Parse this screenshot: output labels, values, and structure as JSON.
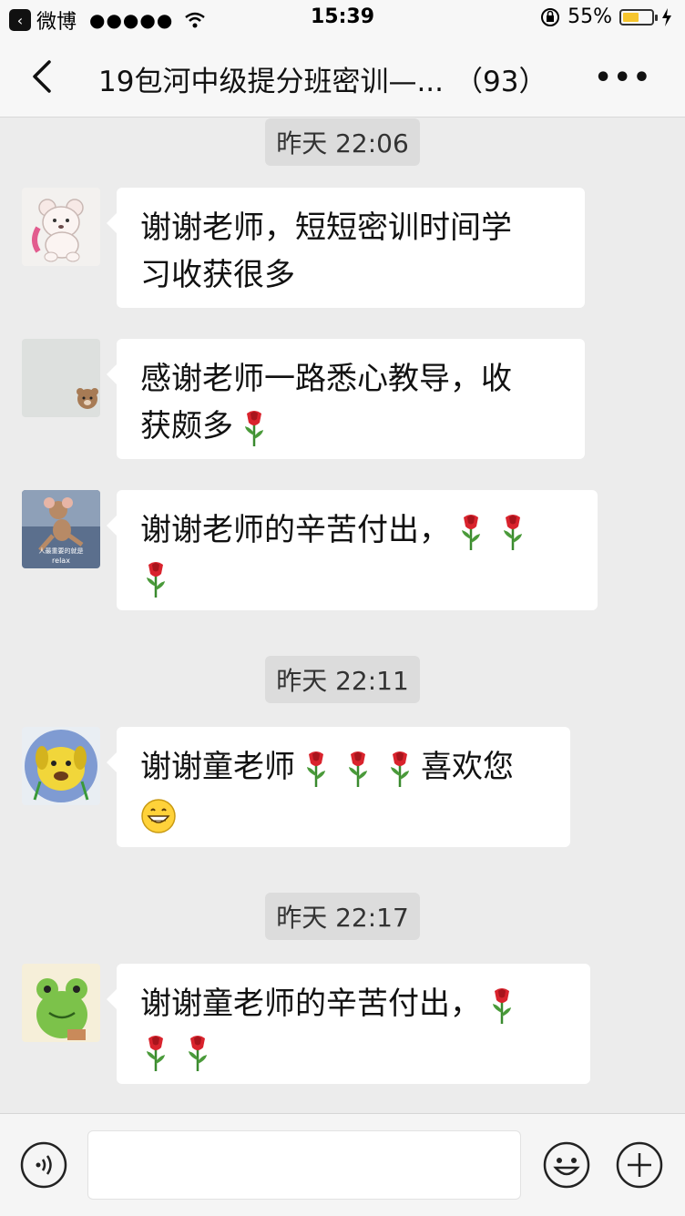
{
  "status_bar": {
    "back_app_label": "微博",
    "signal": "●●●●●",
    "time": "15:39",
    "battery_percent": "55%",
    "battery_level": 0.55
  },
  "nav": {
    "title": "19包河中级提分班密训—...",
    "member_count": "（93）"
  },
  "timestamps": [
    "昨天 22:06",
    "昨天 22:11",
    "昨天 22:17"
  ],
  "messages": [
    {
      "line1": "谢谢老师，短短密训时间学",
      "line2": "习收获很多"
    },
    {
      "line1": "感谢老师一路悉心教导，收",
      "line2": "获颇多"
    },
    {
      "line1": "谢谢老师的辛苦付出，"
    },
    {
      "line1": "谢谢童老师",
      "after": "喜欢您"
    },
    {
      "line1": "谢谢童老师的辛苦付出，"
    }
  ],
  "avatar_captions": {
    "a3_line1": "人最重要的就是",
    "a3_line2": "relax"
  },
  "icons": {
    "back": "chevron-left-icon",
    "more": "more-icon",
    "voice": "voice-icon",
    "emoji": "emoji-icon",
    "plus": "plus-icon"
  }
}
